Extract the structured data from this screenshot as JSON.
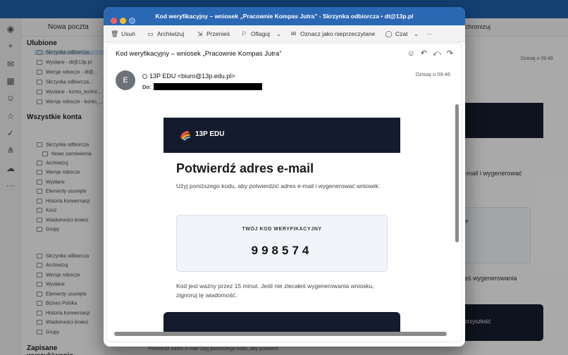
{
  "background": {
    "compose_label": "Nowa poczta",
    "favorites_header": "Ulubione",
    "all_accounts_header": "Wszystkie konta",
    "saved_searches_header": "Zapisane wyszukiwania",
    "favorites": [
      "Skrzynka odbiorcza...",
      "Wysłane - dt@13p.pl",
      "Wersje robocze - dt@...",
      "Skrzynka odbiorcza...",
      "Wysłane - konto_techni...",
      "Wersje robocze - konto_..."
    ],
    "account1": [
      "Skrzynka odbiorcza",
      "Nowe zamówienia",
      "Archiwizuj",
      "Wersje robocze",
      "Wysłane",
      "Elementy usunięte",
      "Historia konwersacji",
      "Kosz",
      "Wiadomości-śmieci",
      "Grupy"
    ],
    "account2": [
      "Skrzynka odbiorcza",
      "Archiwizuj",
      "Wersje robocze",
      "Wysłane",
      "Elementy usunięte",
      "Biznes Polska",
      "Historia konwersacji",
      "Wiadomości-śmieci",
      "Grupy"
    ],
    "right_sync": "chronizuj",
    "right_date": "Dzisiaj o 09:46",
    "right_text1": "-mail i wygenerować",
    "right_text2": "Y",
    "right_text3": "eś wygenerowania",
    "right_text4": "przyszłość",
    "bottom_preview": "Potwierdź adres e-mail Użyj poniższego kodu, aby potwierd"
  },
  "window": {
    "title": "Kod weryfikacyjny – wniosek „Pracownie Kompas Jutra” - Skrzynka odbiorcza • dt@13p.pl"
  },
  "toolbar": {
    "delete": "Usuń",
    "archive": "Archiwizuj",
    "move": "Przenieś",
    "flag": "Oflaguj",
    "mark_unread": "Oznacz jako nieprzeczytane",
    "chat": "Czat",
    "more": "···"
  },
  "message": {
    "subject": "Kod weryfikacyjny – wniosek „Pracownie Kompas Jutra”",
    "avatar_initial": "E",
    "sender": "13P EDU <biuro@13p.edu.pl>",
    "to_label": "Do:",
    "date": "Dzisiaj o 09:46"
  },
  "email": {
    "brand_name": "13P EDU",
    "title": "Potwierdź adres e-mail",
    "intro": "Użyj poniższego kodu, aby potwierdzić adres e-mail i wygenerować wniosek:",
    "code_label": "TWÓJ KOD WERYFIKACYJNY",
    "code_value": "998574",
    "validity": "Kod jest ważny przez 15 minut. Jeśli nie zlecałeś wygenerowania wniosku, zignoruj tę wiadomość."
  },
  "colors": {
    "titlebar": "#2b68b4",
    "brand_banner": "#141b2d",
    "code_box": "#f1f5fa"
  }
}
